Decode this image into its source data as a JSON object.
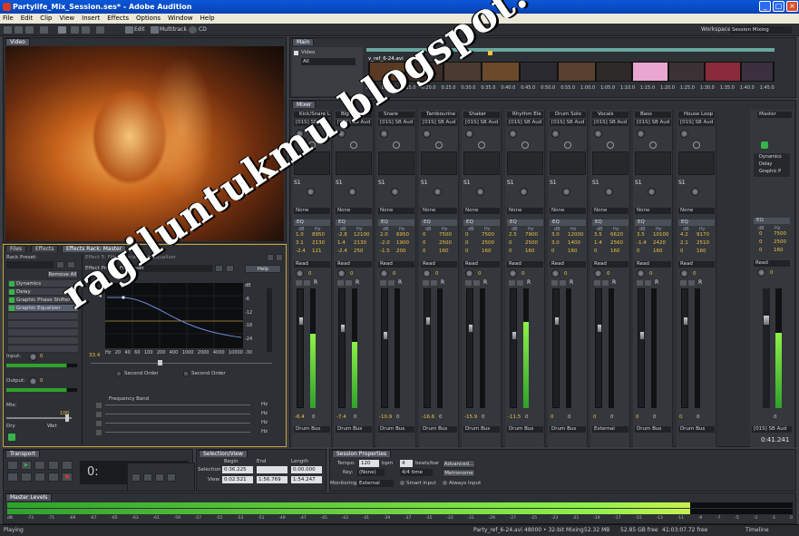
{
  "window": {
    "title": "Partylife_Mix_Session.ses* - Adobe Audition",
    "min": "_",
    "max": "□",
    "close": "×"
  },
  "menu": [
    "File",
    "Edit",
    "Clip",
    "View",
    "Insert",
    "Effects",
    "Options",
    "Window",
    "Help"
  ],
  "toolbar": {
    "edit": "Edit",
    "multitrack": "Multitrack",
    "cd": "CD",
    "workspace_label": "Workspace:",
    "workspace": "Session Mixing"
  },
  "video_panel": {
    "tab": "Video"
  },
  "main_panel": {
    "tab": "Main",
    "video_label": "Video",
    "filter": "All",
    "clip_name": "v_ref_6-24.avi",
    "ruler": [
      "hms",
      "0:10.0",
      "0:15.0",
      "0:20.0",
      "0:25.0",
      "0:30.0",
      "0:35.0",
      "0:40.0",
      "0:45.0",
      "0:50.0",
      "0:55.0",
      "1:00.0",
      "1:05.0",
      "1:10.0",
      "1:15.0",
      "1:20.0",
      "1:25.0",
      "1:30.0",
      "1:35.0",
      "1:40.0",
      "1:45.0",
      "hms"
    ]
  },
  "effects_panel": {
    "tabs": [
      "Files",
      "Effects",
      "Effects Rack: Master"
    ],
    "rack_preset_label": "Rack Preset:",
    "remove_all": "Remove All",
    "effects": [
      "Dynamics",
      "Delay",
      "Graphic Phase Shifter",
      "Graphic Equalizer",
      "",
      "",
      "",
      "",
      ""
    ],
    "input_label": "Input:",
    "input_db": "0",
    "output_label": "Output:",
    "output_db": "0",
    "mix_label": "Mix:",
    "dry": "Dry",
    "wet": "Wet",
    "mix_value": "100",
    "effect_header": "Effect 5: Filters\\Parametric Equalizer",
    "effect_preset_label": "Effect Preset:",
    "effect_preset": "Full Reset",
    "help": "Help",
    "db_scale": [
      "dB",
      "-6",
      "-12",
      "-18",
      "-24",
      "-30"
    ],
    "hz_scale": [
      "Hz",
      "20",
      "40",
      "60",
      "100",
      "200",
      "400",
      "1000",
      "2000",
      "4000",
      "10000"
    ],
    "gain_value": "33.4",
    "second_order": "Second Order",
    "freq_band": "Frequency Band",
    "hz": "Hz"
  },
  "mixer": {
    "tab": "Mixer",
    "tracks": [
      {
        "name": "Kick/Snare L",
        "input": "[01S] SB Aud",
        "eq": [
          [
            "1.0",
            "8950"
          ],
          [
            "3.1",
            "2130"
          ],
          [
            "-2.4",
            "121"
          ]
        ],
        "read": "Read",
        "pan": "0",
        "db": "-6.4",
        "bus": "Drum Bus",
        "level": 0.62
      },
      {
        "name": "Big Kick",
        "input": "[01S] SB Aud",
        "eq": [
          [
            "-2.8",
            "12100"
          ],
          [
            "1.4",
            "2130"
          ],
          [
            "-2.4",
            "250"
          ]
        ],
        "read": "Read",
        "pan": "0",
        "db": "-7.4",
        "bus": "Drum Bus",
        "level": 0.55
      },
      {
        "name": "Snare",
        "input": "[01S] SB Aud",
        "eq": [
          [
            "2.0",
            "6950"
          ],
          [
            "-2.0",
            "1900"
          ],
          [
            "-1.5",
            "200"
          ]
        ],
        "read": "Read",
        "pan": "0",
        "db": "-10.9",
        "bus": "Drum Bus",
        "level": 0.0
      },
      {
        "name": "Tambourine",
        "input": "[01S] SB Aud",
        "eq": [
          [
            "0",
            "7500"
          ],
          [
            "0",
            "2500"
          ],
          [
            "0",
            "160"
          ]
        ],
        "read": "Read",
        "pan": "0",
        "db": "-16.6",
        "bus": "Drum Bus",
        "level": 0.0
      },
      {
        "name": "Shaker",
        "input": "[01S] SB Aud",
        "eq": [
          [
            "0",
            "7500"
          ],
          [
            "0",
            "2500"
          ],
          [
            "0",
            "160"
          ]
        ],
        "read": "Read",
        "pan": "0",
        "db": "-15.9",
        "bus": "Drum Bus",
        "level": 0.0
      },
      {
        "name": "Rhythm Ele",
        "input": "[01S] SB Aud",
        "eq": [
          [
            "2.5",
            "7900"
          ],
          [
            "0",
            "2500"
          ],
          [
            "0",
            "160"
          ]
        ],
        "read": "Read",
        "pan": "0",
        "db": "-11.5",
        "bus": "Drum Bus",
        "level": 0.72
      },
      {
        "name": "Drum Solo",
        "input": "[01S] SB Aud",
        "eq": [
          [
            "3.0",
            "12000"
          ],
          [
            "3.0",
            "1400"
          ],
          [
            "0",
            "160"
          ]
        ],
        "read": "Read",
        "pan": "0",
        "db": "0",
        "bus": "Drum Bus",
        "level": 0.0
      },
      {
        "name": "Vocals",
        "input": "[01S] SB Aud",
        "eq": [
          [
            "3.5",
            "6620"
          ],
          [
            "1.4",
            "2560"
          ],
          [
            "0",
            "160"
          ]
        ],
        "read": "Read",
        "pan": "0",
        "db": "0",
        "bus": "External",
        "level": 0.0
      },
      {
        "name": "Bass",
        "input": "[01S] SB Aud",
        "eq": [
          [
            "3.5",
            "10100"
          ],
          [
            "-1.4",
            "2420"
          ],
          [
            "0",
            "160"
          ]
        ],
        "read": "Read",
        "pan": "0",
        "db": "0",
        "bus": "Drum Bus",
        "level": 0.0
      },
      {
        "name": "House Loop",
        "input": "[01S] SB Aud",
        "eq": [
          [
            "4.2",
            "9170"
          ],
          [
            "2.1",
            "2510"
          ],
          [
            "0",
            "160"
          ]
        ],
        "read": "Read",
        "pan": "0",
        "db": "0",
        "bus": "Drum Bus",
        "level": 0.0
      }
    ],
    "master": {
      "name": "Master",
      "eq": [
        [
          "0",
          "7500"
        ],
        [
          "0",
          "2500"
        ],
        [
          "0",
          "160"
        ]
      ],
      "read": "Read",
      "pan": "0",
      "db": "0",
      "output": "[01S] SB Aud",
      "time": "0:41.241",
      "level": 0.63,
      "effects": [
        "Dynamics",
        "Delay",
        "Graphic P"
      ]
    },
    "none": "None",
    "eq_label": "EQ",
    "db_label": "dB",
    "hz_label": "Hz"
  },
  "transport": {
    "tab": "Transport",
    "time": "0:"
  },
  "selection": {
    "tab": "Selection/View",
    "begin_label": "Begin",
    "end_label": "End",
    "length_label": "Length",
    "selection_label": "Selection",
    "view_label": "View",
    "sel_begin": "0:36.225",
    "sel_end": "",
    "sel_length": "0:00.000",
    "view_begin": "0:02.521",
    "view_end": "1:56.769",
    "view_length": "1:54.247"
  },
  "session": {
    "tab": "Session Properties",
    "tempo_label": "Tempo:",
    "tempo": "120",
    "bpm": "bpm",
    "beats": "4",
    "beats_label": "beats/bar",
    "advanced": "Advanced...",
    "key_label": "Key:",
    "key": "(None)",
    "time_sig": "4/4 time",
    "metronome": "Metronome",
    "monitoring_label": "Monitoring:",
    "monitoring": "External",
    "smart_input": "Smart Input",
    "always_input": "Always Input"
  },
  "master_levels": {
    "tab": "Master Levels",
    "scale": [
      "dB",
      "-73",
      "-71",
      "-69",
      "-67",
      "-65",
      "-63",
      "-61",
      "-59",
      "-57",
      "-55",
      "-53",
      "-51",
      "-49",
      "-47",
      "-45",
      "-43",
      "-41",
      "-39",
      "-37",
      "-35",
      "-33",
      "-31",
      "-29",
      "-27",
      "-25",
      "-23",
      "-21",
      "-19",
      "-17",
      "-15",
      "-13",
      "-11",
      "-9",
      "-7",
      "-5",
      "-3",
      "-1",
      "0"
    ],
    "left": 0.87,
    "right": 0.87
  },
  "status": {
    "state": "Playing",
    "file": "Party_ref_6-24.avi",
    "format": "48000 • 32-bit Mixing",
    "mem": "52.32 MB",
    "free": "52.85 GB free",
    "time_free": "41:03:07.72 free",
    "mode": "Timeline"
  },
  "watermark": {
    "main": "ragiluntukmu.blogspot.com"
  }
}
